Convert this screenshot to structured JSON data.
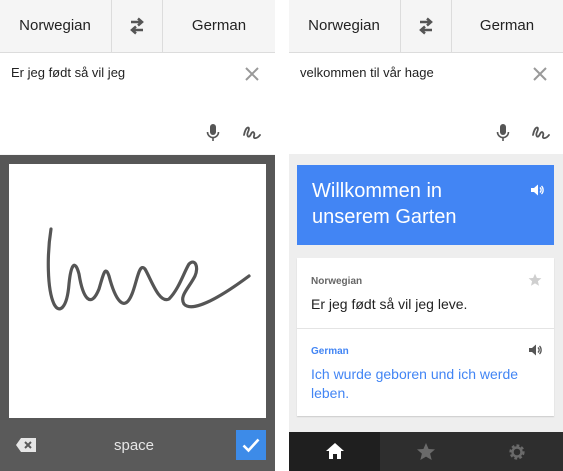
{
  "left": {
    "source_lang": "Norwegian",
    "target_lang": "German",
    "input_text": "Er jeg født så vil jeg",
    "keyboard": {
      "space_label": "space"
    }
  },
  "right": {
    "source_lang": "Norwegian",
    "target_lang": "German",
    "input_text": "velkommen til vår hage",
    "result_text": "Willkommen in unserem Garten",
    "history": {
      "source_label": "Norwegian",
      "source_text": "Er jeg født så vil jeg leve.",
      "target_label": "German",
      "target_text": "Ich wurde geboren und ich werde leben."
    }
  },
  "colors": {
    "accent": "#4285f4",
    "done": "#3d8be8",
    "nav_bg": "#2e2e2e",
    "canvas_frame": "#575757"
  },
  "icons": [
    "swap-icon",
    "clear-icon",
    "mic-icon",
    "handwriting-icon",
    "backspace-icon",
    "check-icon",
    "speaker-icon",
    "star-icon",
    "home-icon",
    "gear-icon"
  ]
}
